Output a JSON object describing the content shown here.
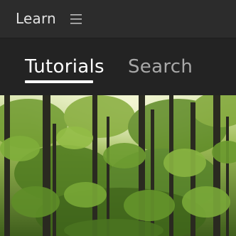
{
  "header": {
    "title": "Learn",
    "menu_icon": "hamburger-menu-icon"
  },
  "tabs": [
    {
      "label": "Tutorials",
      "active": true
    },
    {
      "label": "Search",
      "active": false
    }
  ],
  "hero": {
    "image": "forest-photo"
  },
  "colors": {
    "panel_bg": "#232323",
    "header_bg": "#2c2c2c",
    "active_tab": "#ffffff",
    "inactive_tab": "#a8a8a8"
  }
}
